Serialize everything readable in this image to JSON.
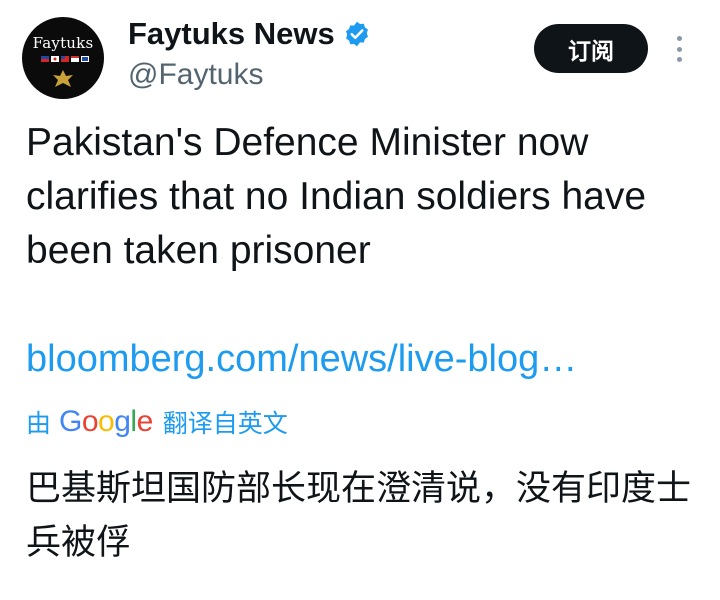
{
  "avatar": {
    "text": "Faytuks",
    "icon": "faytuks-logo"
  },
  "author": {
    "name": "Faytuks News",
    "handle": "@Faytuks",
    "verified_icon": "verified-badge-icon"
  },
  "subscribe_label": "订阅",
  "more_icon": "more-vertical-icon",
  "tweet": {
    "text": "Pakistan's Defence Minister now clarifies that no Indian soldiers have been taken prisoner",
    "link": "bloomberg.com/news/live-blog…"
  },
  "translation": {
    "prefix": "由",
    "provider": "Google",
    "label": "翻译自英文",
    "text": "巴基斯坦国防部长现在澄清说，没有印度士兵被俘"
  },
  "colors": {
    "accent": "#1d9bf0",
    "verified": "#1d9bf0",
    "button_bg": "#0f1419"
  }
}
